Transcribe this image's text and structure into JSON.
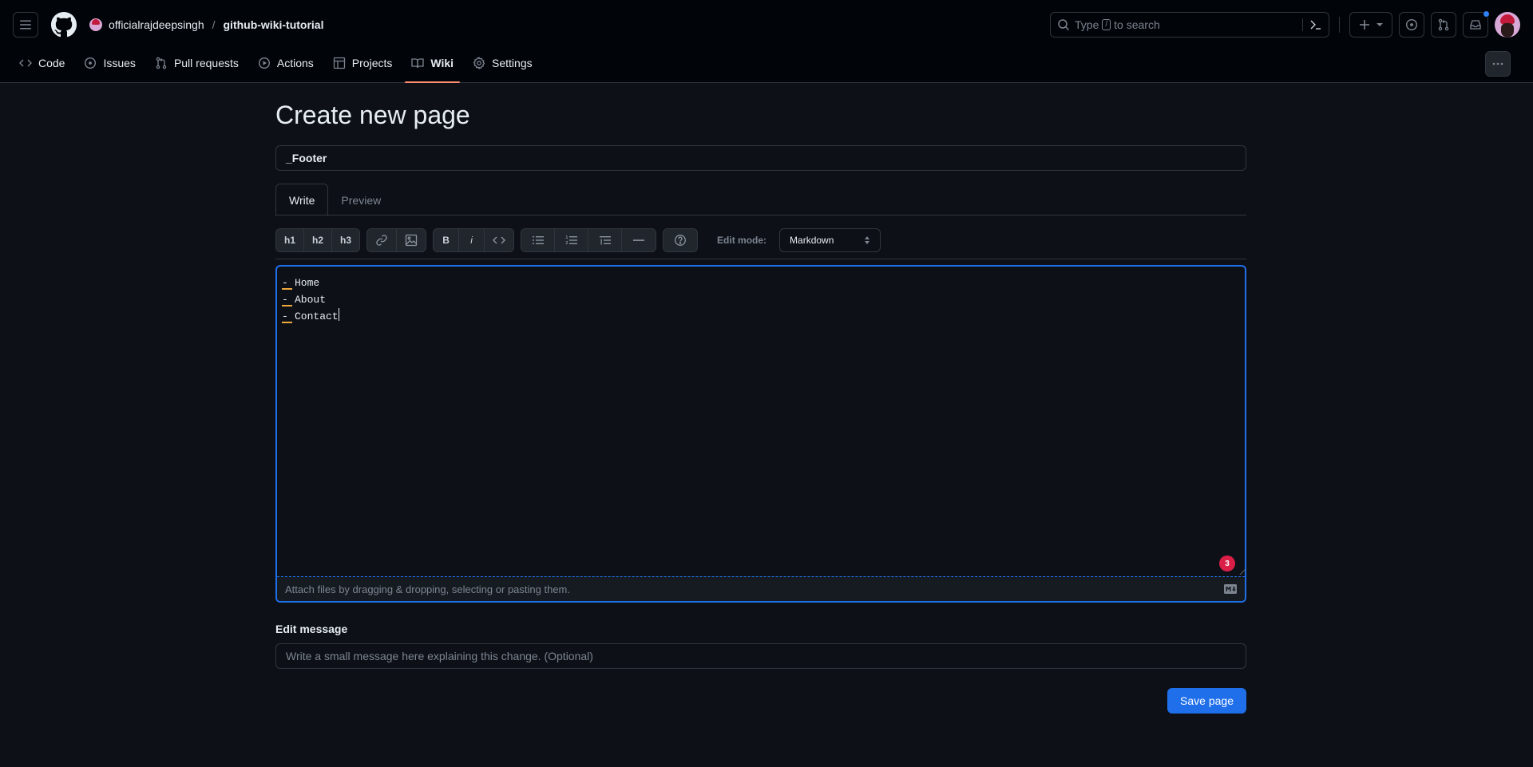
{
  "header": {
    "owner": "officialrajdeepsingh",
    "separator": "/",
    "repo": "github-wiki-tutorial",
    "search": {
      "prefix": "Type",
      "key": "/",
      "suffix": "to search"
    },
    "notification_dot_color": "#2f81f7"
  },
  "nav": {
    "items": [
      {
        "label": "Code",
        "icon": "code-icon"
      },
      {
        "label": "Issues",
        "icon": "issue-opened-icon"
      },
      {
        "label": "Pull requests",
        "icon": "git-pull-request-icon"
      },
      {
        "label": "Actions",
        "icon": "play-icon"
      },
      {
        "label": "Projects",
        "icon": "table-icon"
      },
      {
        "label": "Wiki",
        "icon": "book-icon",
        "active": true
      },
      {
        "label": "Settings",
        "icon": "gear-icon"
      }
    ],
    "active_underline_color": "#fd8c73"
  },
  "page": {
    "title": "Create new page",
    "page_name_value": "_Footer",
    "tabs": {
      "write": "Write",
      "preview": "Preview"
    },
    "toolbar": {
      "h1": "h1",
      "h2": "h2",
      "h3": "h3",
      "bold": "B",
      "italic": "i",
      "edit_mode_label": "Edit mode:",
      "edit_mode_value": "Markdown"
    },
    "editor": {
      "lines": [
        {
          "marker": "-",
          "text": "Home"
        },
        {
          "marker": "-",
          "text": "About"
        },
        {
          "marker": "-",
          "text": "Contact"
        }
      ],
      "badge_count": "3",
      "attach_hint": "Attach files by dragging & dropping, selecting or pasting them."
    },
    "edit_message": {
      "label": "Edit message",
      "placeholder": "Write a small message here explaining this change. (Optional)"
    },
    "save_label": "Save page",
    "accent_color": "#1f6feb"
  }
}
